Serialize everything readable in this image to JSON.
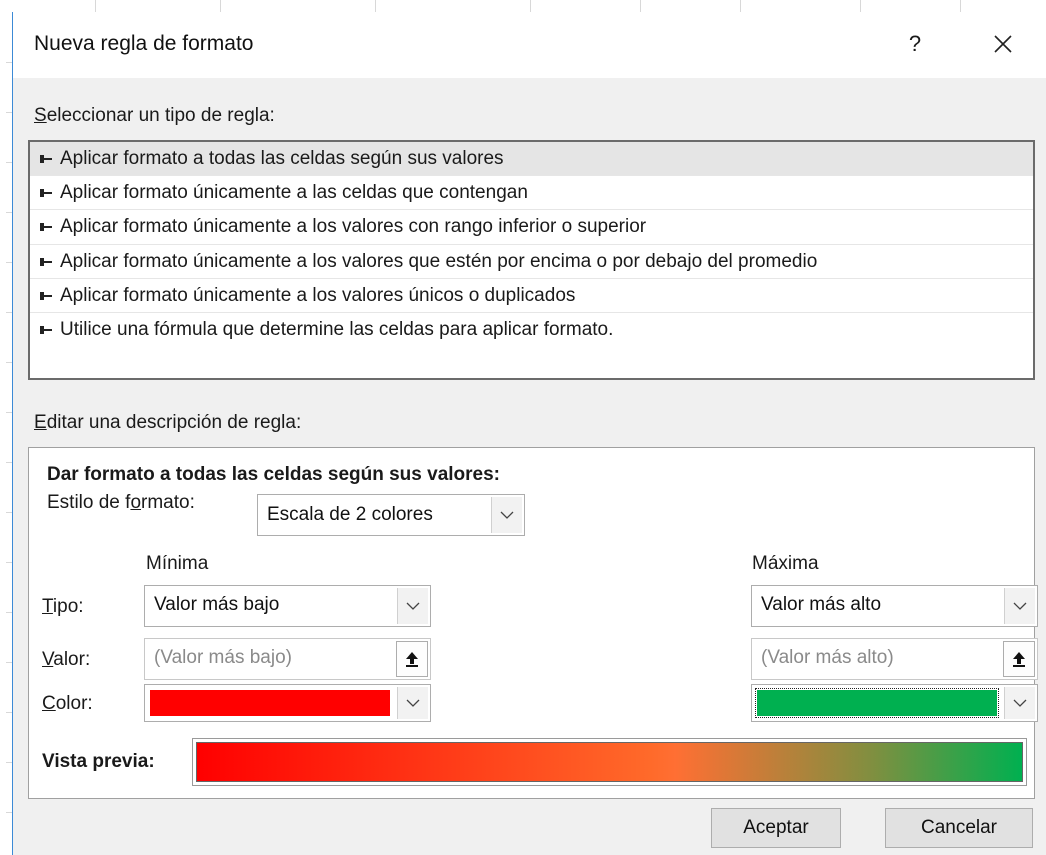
{
  "dialog": {
    "title": "Nueva regla de formato",
    "help_label": "?"
  },
  "rule_types": {
    "label_prefix": "S",
    "label_rest": "eleccionar un tipo de regla:",
    "items": [
      "Aplicar formato a todas las celdas según sus valores",
      "Aplicar formato únicamente a las celdas que contengan",
      "Aplicar formato únicamente a los valores con rango inferior o superior",
      "Aplicar formato únicamente a los valores que estén por encima o por debajo del promedio",
      "Aplicar formato únicamente a los valores únicos o duplicados",
      "Utilice una fórmula que determine las celdas para aplicar formato."
    ],
    "selected_index": 0
  },
  "description": {
    "label_prefix": "E",
    "label_rest": "ditar una descripción de regla:",
    "heading": "Dar formato a todas las celdas según sus valores:",
    "style_label_a": "Estilo de f",
    "style_label_ak": "o",
    "style_label_b": "rmato:",
    "style_value": "Escala de 2 colores",
    "min_header": "Mínima",
    "max_header": "Máxima",
    "tipo_label_ak": "T",
    "tipo_label_rest": "ipo:",
    "valor_label_ak": "V",
    "valor_label_rest": "alor:",
    "color_label_ak": "C",
    "color_label_rest": "olor:",
    "min_type": "Valor más bajo",
    "max_type": "Valor más alto",
    "min_value_placeholder": "(Valor más bajo)",
    "max_value_placeholder": "(Valor más alto)",
    "min_color": "#ff0000",
    "max_color": "#00b050",
    "preview_label": "Vista previa:"
  },
  "buttons": {
    "ok": "Aceptar",
    "cancel": "Cancelar"
  }
}
